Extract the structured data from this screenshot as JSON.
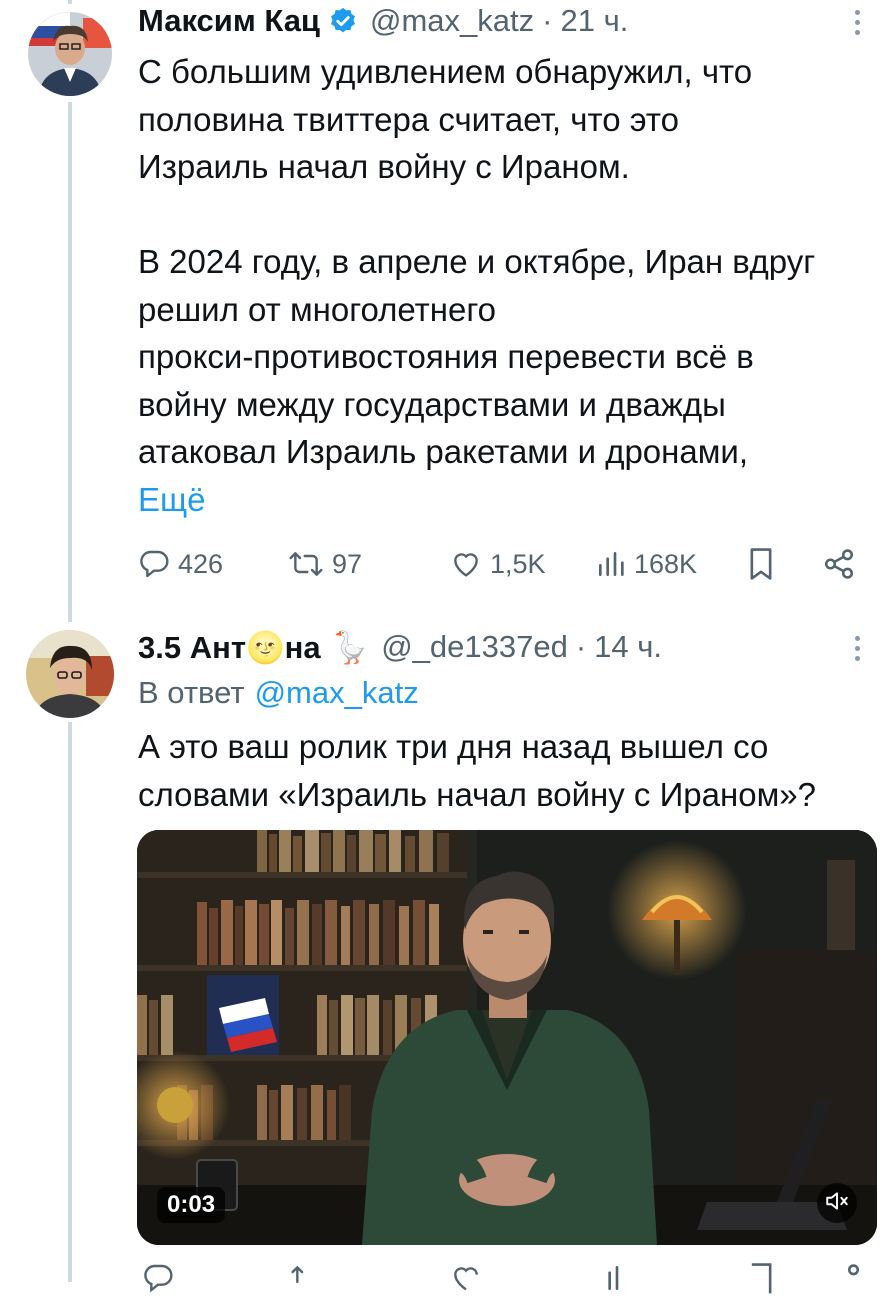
{
  "tweet1": {
    "author_name": "Максим Кац",
    "handle": "@max_katz",
    "dot": "·",
    "time": "21 ч.",
    "text_lines": [
      "С большим удивлением обнаружил, что",
      "половина твиттера считает, что это",
      "Израиль начал войну с Ираном.",
      "",
      "В 2024 году, в апреле и октябре, Иран вдруг",
      "решил от многолетнего",
      "прокси-противостояния перевести всё в",
      "войну между государствами и дважды",
      "атаковал Израиль ракетами и дронами,"
    ],
    "more_link": "Ещё",
    "stats": {
      "replies": "426",
      "retweets": "97",
      "likes": "1,5K",
      "views": "168K"
    },
    "icons": {
      "verified": "verified-badge-icon",
      "reply": "reply-icon",
      "retweet": "retweet-icon",
      "like": "heart-icon",
      "views": "views-icon",
      "bookmark": "bookmark-icon",
      "share": "share-icon"
    }
  },
  "tweet2": {
    "author_name_part1": "3.5 Ант",
    "author_emoji": "🌝",
    "author_name_part2": "на",
    "goose_emoji": "🪿",
    "handle": "@_de1337ed",
    "dot": "·",
    "time": "14 ч.",
    "reply_prefix": "В ответ",
    "reply_to": "@max_katz",
    "text_lines": [
      "А это ваш ролик три дня назад вышел со",
      "словами «Израиль начал войну с Ираном»?"
    ],
    "video": {
      "duration": "0:03",
      "mute_icon": "mute-icon"
    }
  },
  "colors": {
    "accent": "#1d9bf0",
    "muted": "#536471",
    "thread_line": "#cfd9de",
    "text": "#0f1419"
  }
}
